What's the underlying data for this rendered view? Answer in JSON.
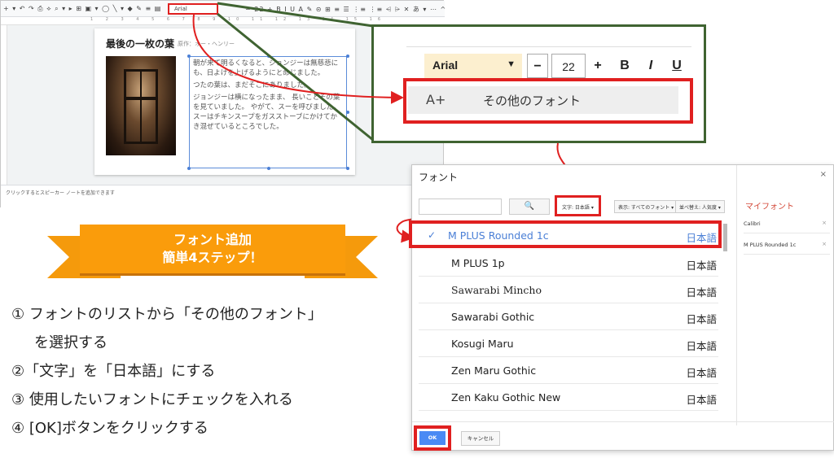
{
  "editor": {
    "toolbar_icons": "+ ▾ ↶ ↷ ⎙ ⟡   ⌕ ▾ ▸ ⊞ ▣ ▾ ◯ ╲ ▾ ◆ ✎ ≡ ▤",
    "toolbar_font": "Arial",
    "toolbar_right": "− 22 +  B  I  U  A  ✎   ⊝  ⊞  ≡  ☰  ⋮≡  ⋮≡  ⩤  ⩥  ✕   あ ▾  ⋯   ^",
    "ruler": "1 2 3 4 5 6 7 8 9 10 11 12 13 14 15 16",
    "slide_title": "最後の一枚の葉",
    "slide_author": "原作：オー・ヘンリー",
    "slide_paragraphs": [
      "朝が来て明るくなると、ジョンジーは無慈悲にも、日よけを上げるようにと命じました。",
      "つたの葉は、まだそこにありました。",
      "ジョンジーは横になったまま、 長いことその葉を見ていました。 やがて、スーを呼びました。 スーはチキンスープをガスストーブにかけてかき混ぜているところでした。"
    ],
    "notes_placeholder": "クリックするとスピーカー ノートを追加できます"
  },
  "callout": {
    "font_name": "Arial",
    "dropdown_arrow": "▼",
    "minus": "−",
    "size": "22",
    "plus": "+",
    "bold": "B",
    "italic": "I",
    "underline": "U",
    "menu_icon": "A+",
    "menu_label": "その他のフォント"
  },
  "dialog": {
    "title": "フォント",
    "close": "×",
    "search_icon": "🔍",
    "filter_script": "文字: 日本語 ▾",
    "filter_show": "表示: すべてのフォント ▾",
    "filter_sort": "並べ替え: 人気度 ▾",
    "fonts": [
      {
        "name": "M PLUS Rounded 1c",
        "lang": "日本語",
        "checked": true
      },
      {
        "name": "M PLUS 1p",
        "lang": "日本語",
        "checked": false
      },
      {
        "name": "Sawarabi Mincho",
        "lang": "日本語",
        "checked": false
      },
      {
        "name": "Sawarabi Gothic",
        "lang": "日本語",
        "checked": false
      },
      {
        "name": "Kosugi Maru",
        "lang": "日本語",
        "checked": false
      },
      {
        "name": "Zen Maru Gothic",
        "lang": "日本語",
        "checked": false
      },
      {
        "name": "Zen Kaku Gothic New",
        "lang": "日本語",
        "checked": false
      }
    ],
    "check_mark": "✓",
    "my_fonts_title": "マイフォント",
    "my_fonts": [
      {
        "name": "Calibri",
        "remove": "×"
      },
      {
        "name": "M PLUS Rounded 1c",
        "remove": "×"
      }
    ],
    "ok_label": "OK",
    "cancel_label": "キャンセル"
  },
  "banner": {
    "line1": "フォント追加",
    "line2": "簡単4ステップ！"
  },
  "steps": [
    "① フォントのリストから「その他のフォント」",
    "を選択する",
    "②「文字」を「日本語」にする",
    "③ 使用したいフォントにチェックを入れる",
    "④ [OK]ボタンをクリックする"
  ],
  "colors": {
    "highlight_red": "#e02020",
    "callout_green": "#3f6331",
    "banner_orange": "#fa9c0b",
    "accent_blue": "#4a7fd6"
  }
}
